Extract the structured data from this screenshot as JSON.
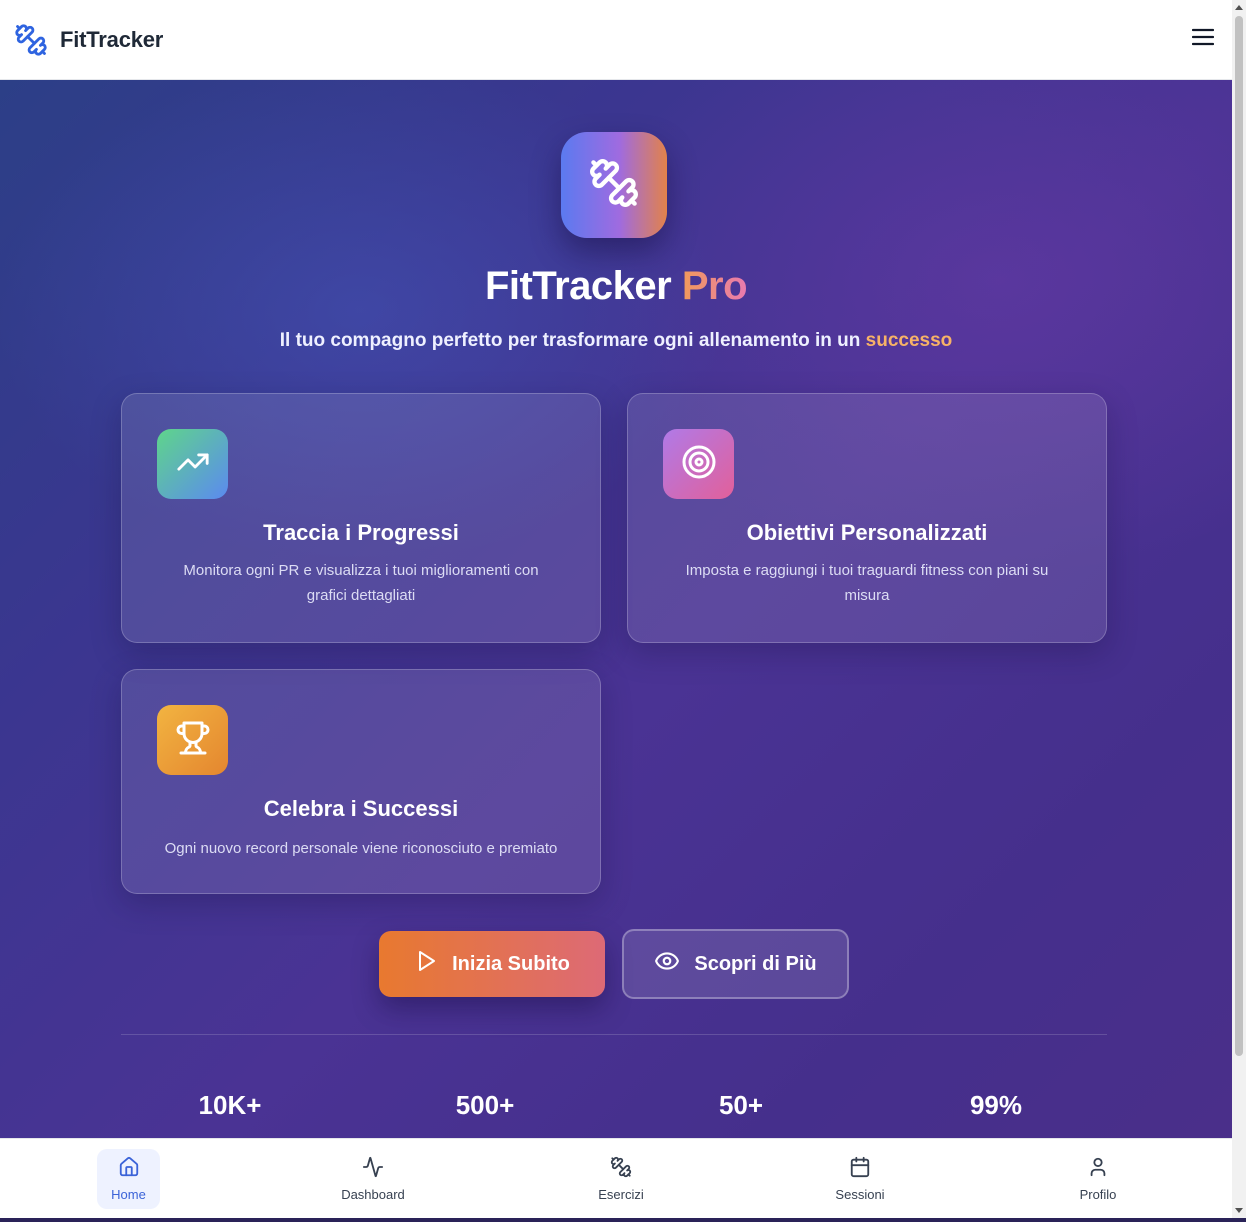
{
  "header": {
    "brand_name": "FitTracker",
    "logo_icon": "dumbbell-icon",
    "menu_icon": "hamburger-menu-icon"
  },
  "hero": {
    "app_icon": "dumbbell-icon",
    "title_main": "FitTracker",
    "title_accent": "Pro",
    "subtitle_main": "Il tuo compagno perfetto per trasformare ogni allenamento in un",
    "subtitle_highlight": "successo"
  },
  "features": [
    {
      "icon": "trending-up-icon",
      "title": "Traccia i Progressi",
      "description": "Monitora ogni PR e visualizza i tuoi miglioramenti con grafici dettagliati"
    },
    {
      "icon": "target-icon",
      "title": "Obiettivi Personalizzati",
      "description": "Imposta e raggiungi i tuoi traguardi fitness con piani su misura"
    },
    {
      "icon": "trophy-icon",
      "title": "Celebra i Successi",
      "description": "Ogni nuovo record personale viene riconosciuto e premiato"
    }
  ],
  "cta": {
    "primary_label": "Inizia Subito",
    "primary_icon": "play-icon",
    "secondary_label": "Scopri di Più",
    "secondary_icon": "eye-icon"
  },
  "stats": [
    {
      "value": "10K+"
    },
    {
      "value": "500+"
    },
    {
      "value": "50+"
    },
    {
      "value": "99%"
    }
  ],
  "bottom_nav": {
    "items": [
      {
        "label": "Home",
        "icon": "home-icon",
        "active": true
      },
      {
        "label": "Dashboard",
        "icon": "activity-icon",
        "active": false
      },
      {
        "label": "Esercizi",
        "icon": "dumbbell-icon",
        "active": false
      },
      {
        "label": "Sessioni",
        "icon": "calendar-icon",
        "active": false
      },
      {
        "label": "Profilo",
        "icon": "user-icon",
        "active": false
      }
    ]
  },
  "colors": {
    "brand_blue": "#3b63d8",
    "accent_orange": "#e8792f",
    "highlight": "#f7b267",
    "hero_bg": "#3f3590"
  }
}
